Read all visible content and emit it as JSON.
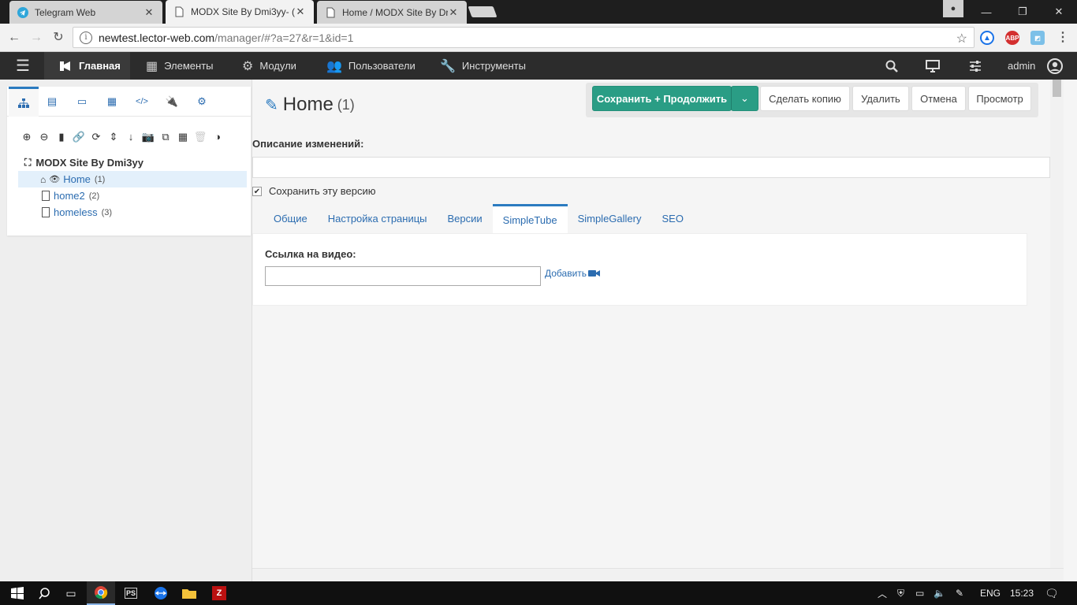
{
  "browser": {
    "tabs": [
      {
        "label": "Telegram Web",
        "active": false
      },
      {
        "label": "MODX Site By Dmi3yy- (",
        "active": true
      },
      {
        "label": "Home / MODX Site By Dr",
        "active": false
      }
    ],
    "url_host": "newtest.lector-web.com",
    "url_path": "/manager/#?a=27&r=1&id=1",
    "ext_abp": "ABP"
  },
  "topnav": {
    "items": [
      {
        "label": "Главная"
      },
      {
        "label": "Элементы"
      },
      {
        "label": "Модули"
      },
      {
        "label": "Пользователи"
      },
      {
        "label": "Инструменты"
      }
    ],
    "user": "admin"
  },
  "tree": {
    "root": "MODX Site By Dmi3yy",
    "nodes": [
      {
        "title": "Home",
        "id": "(1)"
      },
      {
        "title": "home2",
        "id": "(2)"
      },
      {
        "title": "homeless",
        "id": "(3)"
      }
    ]
  },
  "page": {
    "title": "Home",
    "id": "(1)",
    "buttons": {
      "save": "Сохранить + Продолжить",
      "copy": "Сделать копию",
      "delete": "Удалить",
      "cancel": "Отмена",
      "preview": "Просмотр"
    },
    "desc_label": "Описание изменений:",
    "desc_value": "",
    "save_version_label": "Сохранить эту версию",
    "save_version_checked": true,
    "tabs": [
      "Общие",
      "Настройка страницы",
      "Версии",
      "SimpleTube",
      "SimpleGallery",
      "SEO"
    ],
    "active_tab": "SimpleTube",
    "video_label": "Ссылка на видео:",
    "video_value": "",
    "add_label": "Добавить"
  },
  "taskbar": {
    "lang": "ENG",
    "time": "15:23",
    "ps_label": "PS"
  },
  "colors": {
    "primary_button": "#2a9d85",
    "link": "#2b6cb0",
    "nav_bg": "#2c2c2c"
  }
}
